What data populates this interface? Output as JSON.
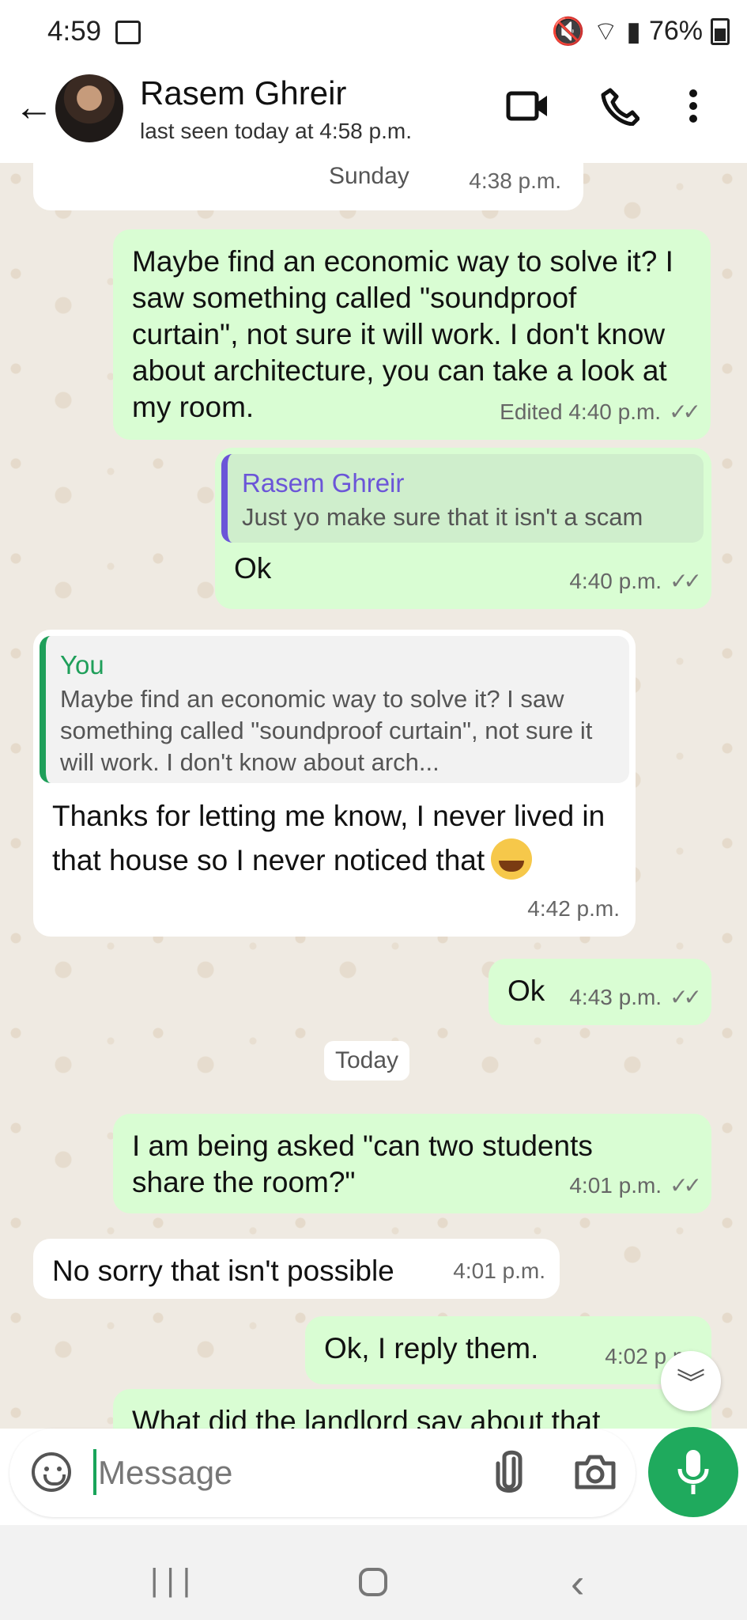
{
  "status": {
    "time": "4:59",
    "battery": "76%"
  },
  "header": {
    "name": "Rasem Ghreir",
    "status": "last seen today at 4:58 p.m."
  },
  "dates": {
    "sunday": "Sunday",
    "today": "Today"
  },
  "messages": {
    "m0_time": "4:38 p.m.",
    "m1_text": "Maybe find an economic way to solve it? I saw something called \"soundproof curtain\", not sure it will work. I don't know about architecture, you can take a look at my room.",
    "m1_meta": "Edited 4:40 p.m.",
    "m2_quote_name": "Rasem Ghreir",
    "m2_quote_text": "Just yo make sure that it isn't a scam",
    "m2_text": "Ok",
    "m2_time": "4:40 p.m.",
    "m3_quote_name": "You",
    "m3_quote_text": "Maybe find an economic way to solve it? I saw something called \"soundproof curtain\", not sure it will work. I don't know about arch...",
    "m3_text": "Thanks for letting me know, I never lived in that house so I never noticed that",
    "m3_time": "4:42 p.m.",
    "m4_text": "Ok",
    "m4_time": "4:43 p.m.",
    "m5_text": "I am being asked \"can two students share the room?\"",
    "m5_time": "4:01 p.m.",
    "m6_text": "No sorry that isn't possible",
    "m6_time": "4:01 p.m.",
    "m7_text": "Ok, I reply them.",
    "m7_time": "4:02 p.m.",
    "m8_text": "What did the landlord say about that"
  },
  "composer": {
    "placeholder": "Message"
  },
  "colors": {
    "accent": "#1faa5d",
    "outgoing": "#d9fdd3",
    "quote_purple": "#6b55d8",
    "quote_green": "#1f9f5a"
  }
}
